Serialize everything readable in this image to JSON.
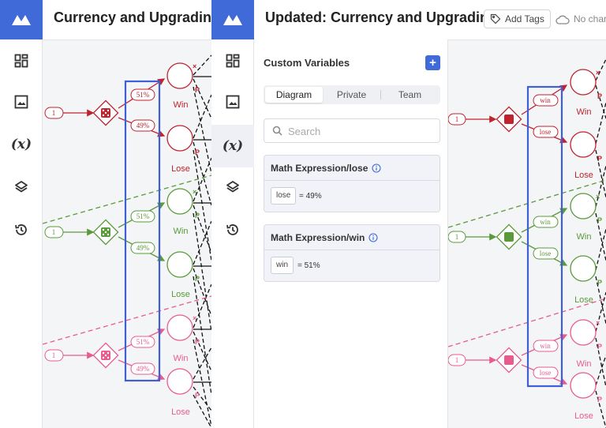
{
  "left": {
    "title": "Currency and Upgrading",
    "prob_labels": [
      "51%",
      "49%",
      "51%",
      "49%",
      "51%",
      "49%"
    ],
    "input_labels": [
      "1",
      "1",
      "1"
    ],
    "outcome_labels": [
      "Win",
      "Lose",
      "Win",
      "Lose",
      "Win",
      "Lose"
    ],
    "p_marks": [
      "P",
      "P",
      "P",
      "P",
      "P",
      "P"
    ],
    "x_marks": [
      "×",
      "×",
      "×"
    ]
  },
  "middle": {
    "title": "Updated: Currency and Upgrading",
    "add_tags_label": "Add Tags",
    "no_changes_label": "No char",
    "panel": {
      "title": "Custom Variables",
      "add_symbol": "+",
      "tabs": [
        "Diagram",
        "Private",
        "Team"
      ],
      "search_placeholder": "Search",
      "variables": [
        {
          "title": "Math Expression/lose",
          "chip": "lose",
          "expr": "= 49%"
        },
        {
          "title": "Math Expression/win",
          "chip": "win",
          "expr": "= 51%"
        }
      ]
    }
  },
  "right": {
    "prob_labels": [
      "win",
      "lose",
      "win",
      "lose",
      "win",
      "lose"
    ],
    "input_labels": [
      "1",
      "1",
      "1"
    ],
    "outcome_labels": [
      "Win",
      "Lose",
      "Win",
      "Lose",
      "Win",
      "Lose"
    ],
    "p_marks": [
      "P",
      "P",
      "P",
      "P",
      "P",
      "P"
    ],
    "x_marks": [
      "×",
      "×",
      "×"
    ]
  },
  "colors": {
    "red": "#c0222e",
    "green": "#5a9a3a",
    "pink": "#e85b8f",
    "accent": "#3f6ad8",
    "highlight": "#3f5fd4"
  }
}
